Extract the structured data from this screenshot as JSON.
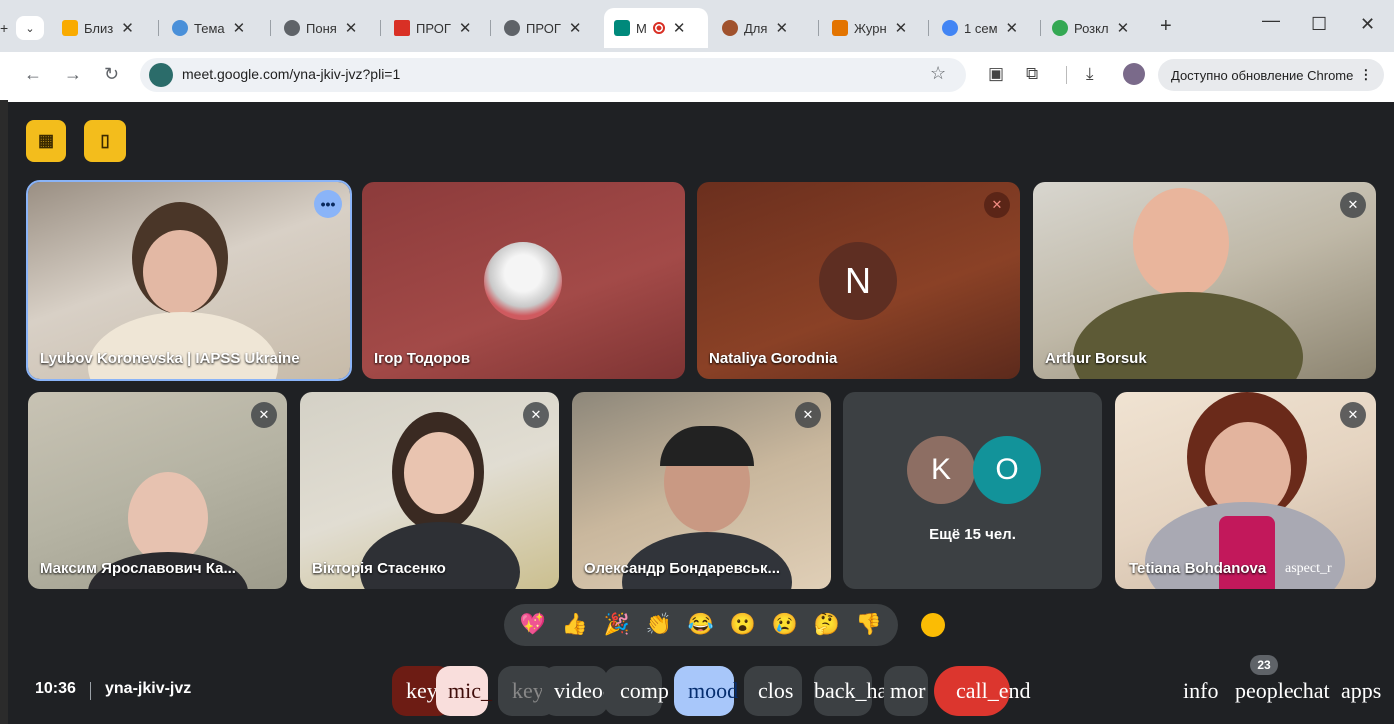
{
  "browser": {
    "tabs": [
      {
        "label": "Близ",
        "color": "#f9ab00"
      },
      {
        "label": "Тема",
        "color": "#4a90d9"
      },
      {
        "label": "Поня",
        "color": "#5f6368"
      },
      {
        "label": "ПРОГ",
        "color": "#d93025"
      },
      {
        "label": "ПРОГ",
        "color": "#5f6368"
      },
      {
        "label": "М",
        "color": "#00897b"
      },
      {
        "label": "Для",
        "color": "#a0522d"
      },
      {
        "label": "Журн",
        "color": "#e37400"
      },
      {
        "label": "1 сем",
        "color": "#4285f4"
      },
      {
        "label": "Розкл",
        "color": "#34a853"
      }
    ],
    "close_glyph": "✕",
    "new_tab_glyph": "+",
    "url": "meet.google.com/yna-jkiv-jvz?pli=1",
    "update_label": "Доступно обновление Chrome"
  },
  "meet": {
    "participants": [
      {
        "name": "Lyubov Koronevska | IAPSS Ukraine"
      },
      {
        "name": "Ігор Тодоров"
      },
      {
        "name": "Nataliya Gorodnia",
        "initial": "N"
      },
      {
        "name": "Arthur Borsuk"
      },
      {
        "name": "Максим Ярославович Ка..."
      },
      {
        "name": "Вікторія Стасенко"
      },
      {
        "name": "Олександр Бондаревськ..."
      },
      {
        "name": "Tetiana Bohdanova",
        "extra": "aspect_r"
      }
    ],
    "more_tile": {
      "initial_1": "K",
      "initial_2": "O",
      "label": "Ещё 15 чел."
    },
    "reactions": [
      "💖",
      "👍",
      "🎉",
      "👏",
      "😂",
      "😮",
      "😢",
      "🤔",
      "👎"
    ],
    "time": "10:36",
    "meeting_code": "yna-jkiv-jvz",
    "controls": {
      "keyboard_1": "key",
      "mic": "mic_",
      "keyboard_2": "key",
      "videocam": "videocam",
      "comp": "comp",
      "mood": "mood",
      "closed_caption": "clos",
      "back_hand": "back_hand",
      "more": "mor",
      "call_end": "call_end"
    },
    "right_controls": {
      "info": "info",
      "people": "people",
      "chat": "chat",
      "apps": "apps"
    },
    "people_count": "23"
  }
}
